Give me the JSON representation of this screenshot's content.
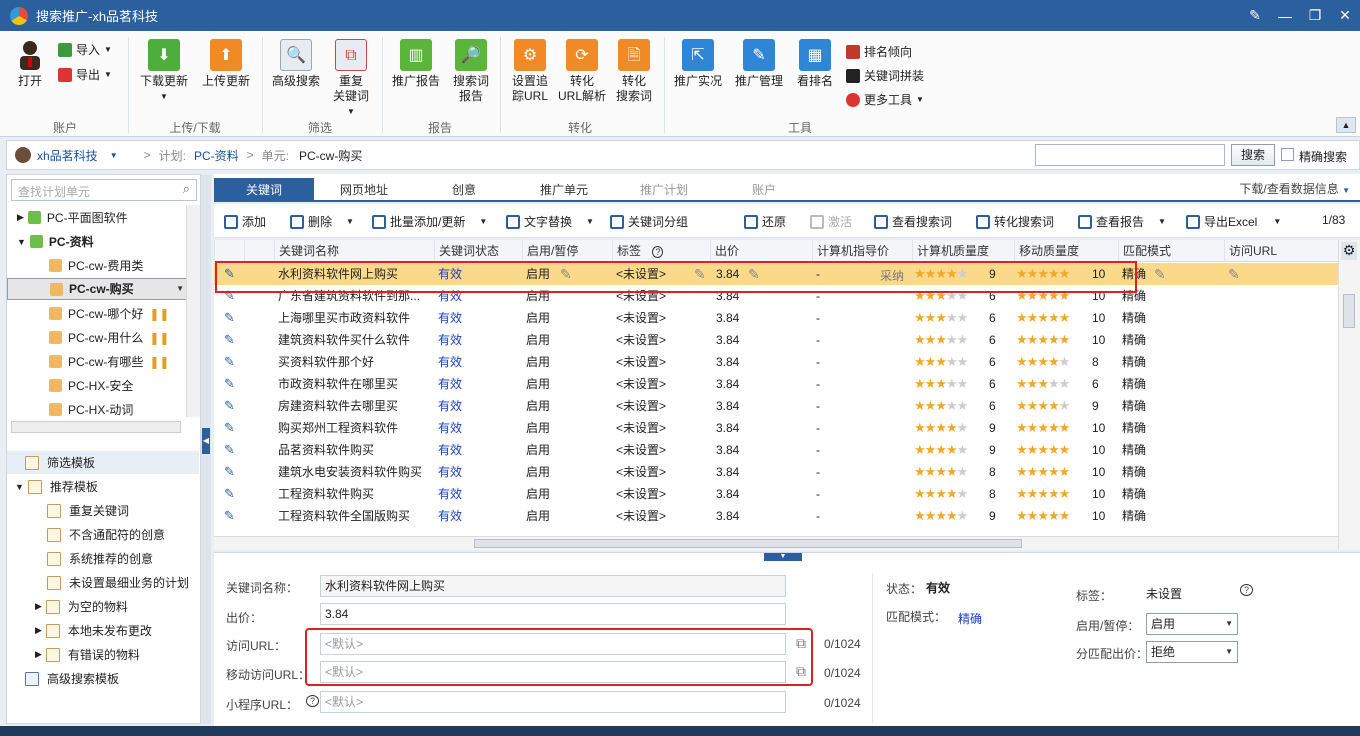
{
  "window": {
    "title": "搜索推广-xh品茗科技"
  },
  "ribbon": {
    "account": {
      "open": "打开",
      "import": "导入",
      "export": "导出",
      "group": "账户"
    },
    "updown": {
      "download": "下载更新",
      "upload": "上传更新",
      "group": "上传/下载"
    },
    "filter": {
      "advanced": "高级搜索",
      "dup_line1": "重复",
      "dup_line2": "关键词",
      "group": "筛选"
    },
    "report": {
      "promo": "推广报告",
      "sq_line1": "搜索词",
      "sq_line2": "报告",
      "group": "报告"
    },
    "convert": {
      "track_line1": "设置追",
      "track_line2": "踪URL",
      "url_line1": "转化",
      "url_line2": "URL解析",
      "sq_line1": "转化",
      "sq_line2": "搜索词",
      "group": "转化"
    },
    "tools": {
      "live": "推广实况",
      "manage": "推广管理",
      "rank": "看排名",
      "rank_trend": "排名倾向",
      "kw_combo": "关键词拼装",
      "more": "更多工具",
      "group": "工具"
    }
  },
  "breadcrumb": {
    "account": "xh品茗科技",
    "plan_label": "计划:",
    "plan": "PC-资料",
    "unit_label": "单元:",
    "unit": "PC-cw-购买",
    "search_button": "搜索",
    "exact_label": "精确搜索"
  },
  "sidebar": {
    "search_placeholder": "查找计划单元",
    "tree": [
      {
        "label": "PC-平面图软件"
      },
      {
        "label": "PC-资料"
      },
      {
        "label": "PC-cw-费用类"
      },
      {
        "label": "PC-cw-购买"
      },
      {
        "label": "PC-cw-哪个好"
      },
      {
        "label": "PC-cw-用什么"
      },
      {
        "label": "PC-cw-有哪些"
      },
      {
        "label": "PC-HX-安全"
      },
      {
        "label": "PC-HX-动词"
      }
    ],
    "templates": {
      "filter": "筛选模板",
      "recommend": "推荐模板",
      "items": [
        "重复关键词",
        "不含通配符的创意",
        "系统推荐的创意",
        "未设置最细业务的计划",
        "为空的物料",
        "本地未发布更改",
        "有错误的物料"
      ],
      "advanced": "高级搜索模板"
    }
  },
  "tabs": {
    "items": [
      "关键词",
      "网页地址",
      "创意",
      "推广单元",
      "推广计划",
      "账户"
    ],
    "download_view": "下载/查看数据信息"
  },
  "toolbar": {
    "add": "添加",
    "delete": "删除",
    "batch": "批量添加/更新",
    "replace": "文字替换",
    "group": "关键词分组",
    "restore": "还原",
    "activate": "激活",
    "view_sq": "查看搜索词",
    "conv_sq": "转化搜索词",
    "view_report": "查看报告",
    "export_excel": "导出Excel",
    "page": "1/83"
  },
  "grid": {
    "headers": [
      "关键词名称",
      "关键词状态",
      "启用/暂停",
      "标签",
      "出价",
      "计算机指导价",
      "计算机质量度",
      "移动质量度",
      "匹配模式",
      "访问URL"
    ],
    "adopt_label": "采纳",
    "rows": [
      {
        "name": "水利资料软件网上购买",
        "status": "有效",
        "enabled": "启用",
        "tag": "<未设置>",
        "bid": "3.84",
        "guide": "-",
        "pc_q": 9,
        "mob_q": 10,
        "match": "精确"
      },
      {
        "name": "广东省建筑资料软件到那...",
        "status": "有效",
        "enabled": "启用",
        "tag": "<未设置>",
        "bid": "3.84",
        "guide": "-",
        "pc_q": 6,
        "mob_q": 10,
        "match": "精确"
      },
      {
        "name": "上海哪里买市政资料软件",
        "status": "有效",
        "enabled": "启用",
        "tag": "<未设置>",
        "bid": "3.84",
        "guide": "-",
        "pc_q": 6,
        "mob_q": 10,
        "match": "精确"
      },
      {
        "name": "建筑资料软件买什么软件",
        "status": "有效",
        "enabled": "启用",
        "tag": "<未设置>",
        "bid": "3.84",
        "guide": "-",
        "pc_q": 6,
        "mob_q": 10,
        "match": "精确"
      },
      {
        "name": "买资料软件那个好",
        "status": "有效",
        "enabled": "启用",
        "tag": "<未设置>",
        "bid": "3.84",
        "guide": "-",
        "pc_q": 6,
        "mob_q": 8,
        "match": "精确"
      },
      {
        "name": "市政资料软件在哪里买",
        "status": "有效",
        "enabled": "启用",
        "tag": "<未设置>",
        "bid": "3.84",
        "guide": "-",
        "pc_q": 6,
        "mob_q": 6,
        "match": "精确"
      },
      {
        "name": "房建资料软件去哪里买",
        "status": "有效",
        "enabled": "启用",
        "tag": "<未设置>",
        "bid": "3.84",
        "guide": "-",
        "pc_q": 6,
        "mob_q": 9,
        "match": "精确"
      },
      {
        "name": "购买郑州工程资料软件",
        "status": "有效",
        "enabled": "启用",
        "tag": "<未设置>",
        "bid": "3.84",
        "guide": "-",
        "pc_q": 9,
        "mob_q": 10,
        "match": "精确"
      },
      {
        "name": "品茗资料软件购买",
        "status": "有效",
        "enabled": "启用",
        "tag": "<未设置>",
        "bid": "3.84",
        "guide": "-",
        "pc_q": 9,
        "mob_q": 10,
        "match": "精确"
      },
      {
        "name": "建筑水电安装资料软件购买",
        "status": "有效",
        "enabled": "启用",
        "tag": "<未设置>",
        "bid": "3.84",
        "guide": "-",
        "pc_q": 8,
        "mob_q": 10,
        "match": "精确"
      },
      {
        "name": "工程资料软件购买",
        "status": "有效",
        "enabled": "启用",
        "tag": "<未设置>",
        "bid": "3.84",
        "guide": "-",
        "pc_q": 8,
        "mob_q": 10,
        "match": "精确"
      },
      {
        "name": "工程资料软件全国版购买",
        "status": "有效",
        "enabled": "启用",
        "tag": "<未设置>",
        "bid": "3.84",
        "guide": "-",
        "pc_q": 9,
        "mob_q": 10,
        "match": "精确"
      }
    ]
  },
  "detail": {
    "name_label": "关键词名称：",
    "name_value": "水利资料软件网上购买",
    "bid_label": "出价：",
    "bid_value": "3.84",
    "url_label": "访问URL：",
    "url_value": "<默认>",
    "url_count": "0/1024",
    "murl_label": "移动访问URL：",
    "murl_value": "<默认>",
    "murl_count": "0/1024",
    "mini_label": "小程序URL：",
    "mini_value": "<默认>",
    "mini_count": "0/1024",
    "status_label": "状态：",
    "status_value": "有效",
    "match_label": "匹配模式：",
    "match_value": "精确",
    "tag_label": "标签：",
    "tag_value": "未设置",
    "enable_label": "启用/暂停：",
    "enable_value": "启用",
    "split_label": "分匹配出价：",
    "split_value": "拒绝"
  }
}
